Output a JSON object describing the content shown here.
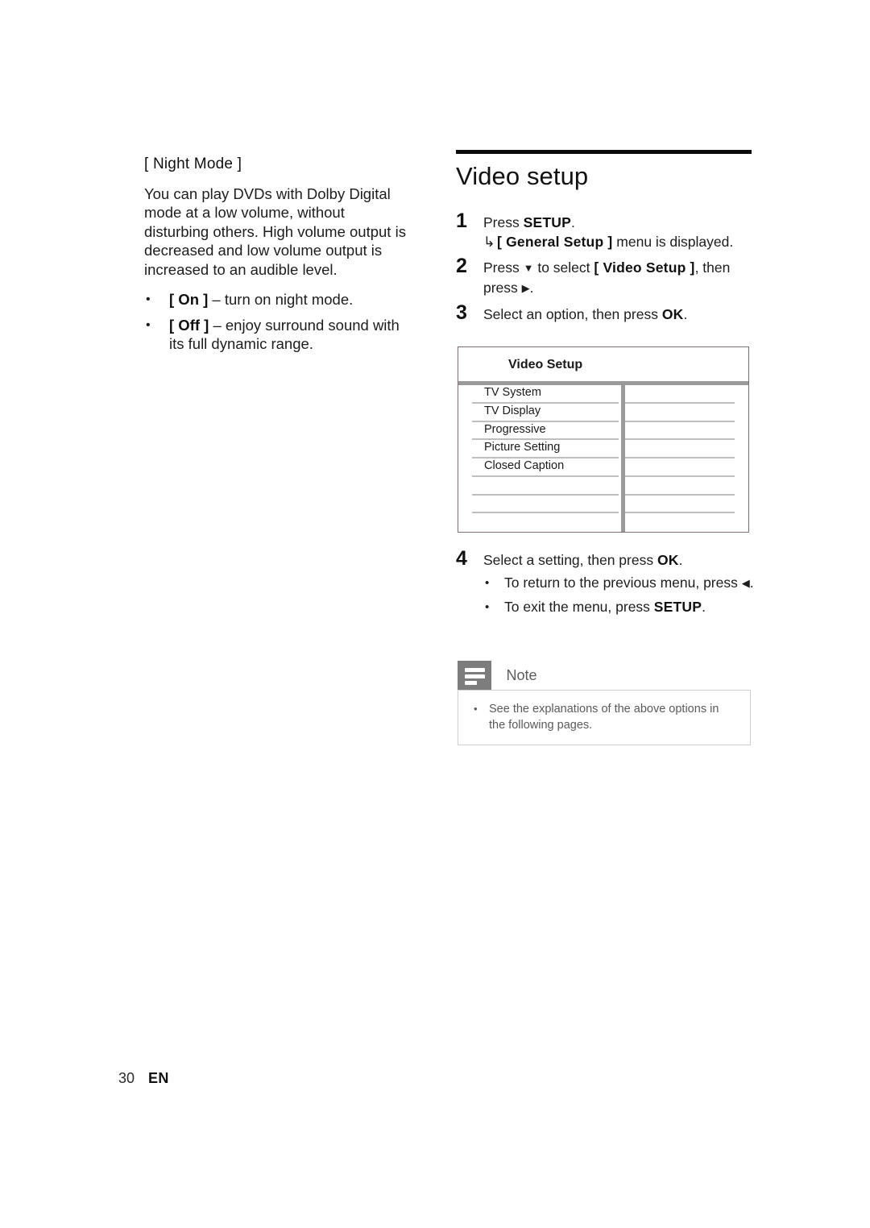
{
  "left_column": {
    "heading": "[ Night Mode ]",
    "paragraph": "You can play DVDs with Dolby Digital mode at a low volume, without disturbing others. High volume output is decreased and low volume output is increased to an audible level.",
    "bullets": [
      {
        "token": "[ On ]",
        "rest": " – turn on night mode."
      },
      {
        "token": "[ Off ]",
        "rest": " – enjoy surround sound with its full dynamic range."
      }
    ]
  },
  "right_column": {
    "title": "Video setup",
    "steps": [
      {
        "num": "1",
        "text_before": "Press ",
        "kbd": "SETUP",
        "text_after": ".",
        "sub_arrow": "↳",
        "sub_before": " ",
        "sub_kbd": "[ General Setup ]",
        "sub_after": " menu is displayed."
      },
      {
        "num": "2",
        "text_before": "Press ",
        "glyph1": "▼",
        "text_mid": " to select ",
        "kbd": "[ Video Setup ]",
        "text_after": ", then press ",
        "glyph2": "▶",
        "text_end": "."
      },
      {
        "num": "3",
        "text_before": "Select an option, then press ",
        "kbd": "OK",
        "text_after": "."
      },
      {
        "num": "4",
        "text_before": "Select a setting, then press ",
        "kbd": "OK",
        "text_after": "."
      }
    ],
    "post_bullets": [
      {
        "text_before": "To return to the previous menu, press ",
        "glyph": "◀",
        "text_after": "."
      },
      {
        "text_before": "To exit the menu, press ",
        "kbd": "SETUP",
        "text_after": "."
      }
    ]
  },
  "menu_box": {
    "header_title": "Video Setup",
    "rows": [
      {
        "label": "TV System"
      },
      {
        "label": "TV Display"
      },
      {
        "label": "Progressive"
      },
      {
        "label": "Picture Setting"
      },
      {
        "label": "Closed Caption"
      },
      {
        "label": ""
      },
      {
        "label": ""
      },
      {
        "label": ""
      }
    ],
    "value_rows": [
      "",
      "",
      "",
      "",
      "",
      "",
      "",
      ""
    ]
  },
  "note": {
    "label": "Note",
    "icon": "note-lines-icon",
    "items": [
      "See the explanations of the above options in the following pages."
    ]
  },
  "footer": {
    "page_number": "30",
    "language": "EN"
  },
  "colors": {
    "rule": "#0b0b0b",
    "menu_divider": "#9a9a9a",
    "note_tab": "#7d7d7d",
    "note_text": "#5a5a5a",
    "row_separator": "#bfbfbf"
  }
}
